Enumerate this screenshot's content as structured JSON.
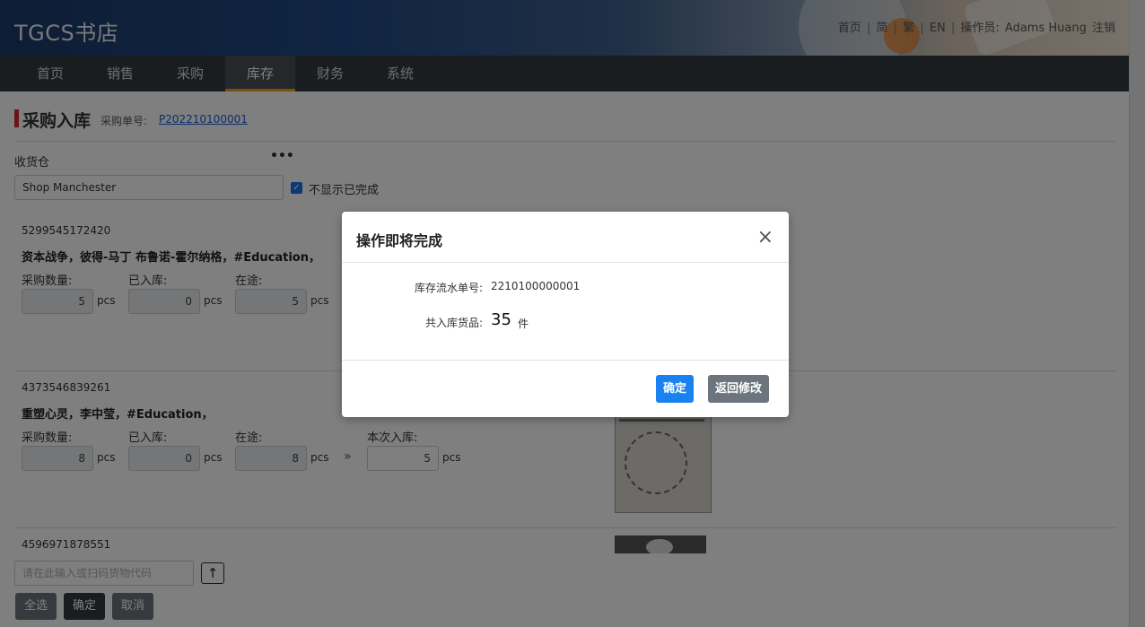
{
  "header": {
    "brand": "TGCS书店",
    "links": {
      "home": "首页",
      "simplified": "简",
      "traditional": "繁",
      "english": "EN",
      "operator_label": "操作员:",
      "operator_name": "Adams Huang",
      "logout": "注销",
      "separator": "|"
    }
  },
  "nav": {
    "items": [
      {
        "label": "首页"
      },
      {
        "label": "销售"
      },
      {
        "label": "采购"
      },
      {
        "label": "库存",
        "active": true
      },
      {
        "label": "财务"
      },
      {
        "label": "系统"
      }
    ]
  },
  "page": {
    "title": "采购入库",
    "po_label": "采购单号:",
    "po_number": "P202210100001",
    "warehouse_label": "收货仓",
    "more_icon": "ellipsis-icon",
    "warehouse_value": "Shop Manchester",
    "hide_completed_label": "不显示已完成",
    "hide_completed_checked": true
  },
  "items": [
    {
      "code": "5299545172420",
      "name": "资本战争，彼得-马丁 布鲁诺-霍尔纳格，#Education，",
      "labels": {
        "ordered": "采购数量:",
        "received": "已入库:",
        "in_transit": "在途:"
      },
      "ordered": "5",
      "received": "0",
      "in_transit": "5",
      "unit": "pcs"
    },
    {
      "code": "4373546839261",
      "name": "重塑心灵，李中莹，#Education，",
      "labels": {
        "ordered": "采购数量:",
        "received": "已入库:",
        "in_transit": "在途:",
        "this_time": "本次入库:"
      },
      "ordered": "8",
      "received": "0",
      "in_transit": "8",
      "this_time": "5",
      "unit": "pcs",
      "arrow": "»"
    },
    {
      "code": "4596971878551"
    }
  ],
  "bottom": {
    "scan_placeholder": "请在此输入或扫码货物代码",
    "upload_icon": "arrow-up-icon",
    "upload_glyph": "↑",
    "select_all": "全选",
    "confirm": "确定",
    "cancel": "取消"
  },
  "modal": {
    "title": "操作即将完成",
    "close_glyph": "×",
    "flow_label": "库存流水单号:",
    "flow_number": "2210100000001",
    "total_label": "共入库货品:",
    "total_count": "35",
    "total_unit": "件",
    "confirm": "确定",
    "back": "返回修改"
  },
  "colors": {
    "nav_bg": "#343a40",
    "active_tab_underline": "#f0a020",
    "title_mark": "#d9292b",
    "link": "#1a5fd0",
    "primary": "#1a82f0",
    "secondary": "#6c757d"
  }
}
